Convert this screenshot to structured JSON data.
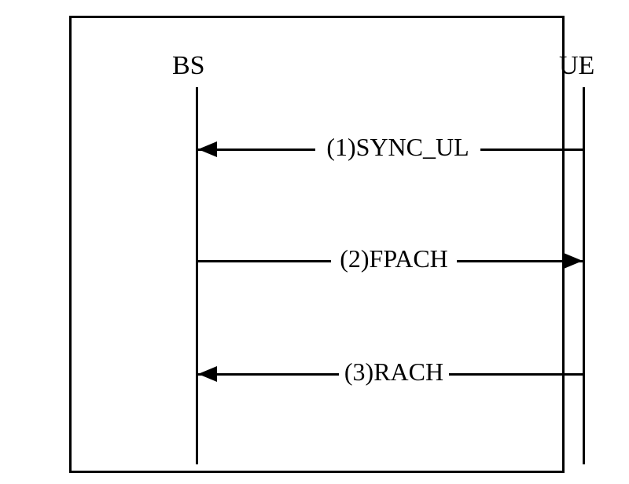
{
  "diagram": {
    "left_entity": "BS",
    "right_entity": "UE",
    "messages": [
      {
        "label": "(1)SYNC_UL",
        "direction": "left"
      },
      {
        "label": "(2)FPACH",
        "direction": "right"
      },
      {
        "label": "(3)RACH",
        "direction": "left"
      }
    ]
  }
}
